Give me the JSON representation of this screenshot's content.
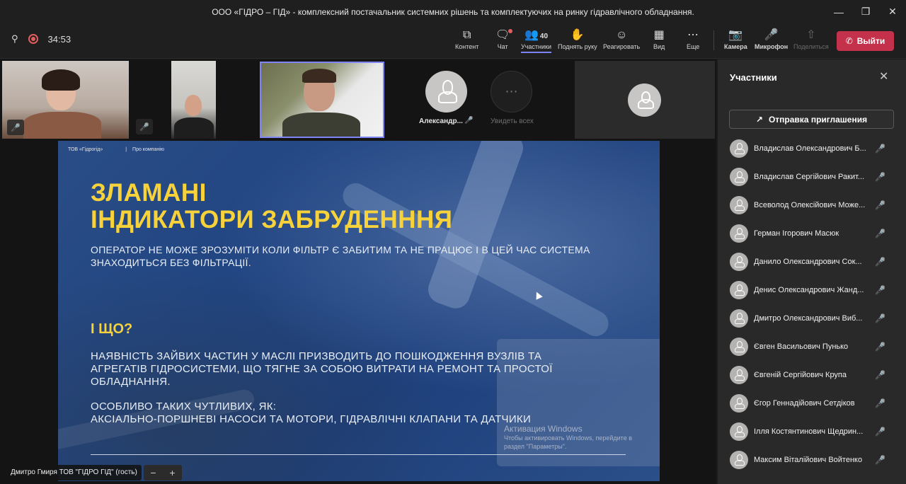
{
  "window": {
    "title": "ООО «ГІДРО – ГІД» - комплексний постачальник системних рішень та комплектуючих на ринку гідравлічного обладнання."
  },
  "toolbar": {
    "timer": "34:53",
    "content_label": "Контент",
    "chat_label": "Чат",
    "participants_label": "Участники",
    "participants_count": "40",
    "raise_hand_label": "Поднять руку",
    "react_label": "Реагировать",
    "view_label": "Вид",
    "more_label": "Еще",
    "camera_label": "Камера",
    "mic_label": "Микрофон",
    "share_label": "Поделиться",
    "leave_label": "Выйти",
    "leave_color": "#c4314b",
    "accent_color": "#7f85f5"
  },
  "strip": {
    "tile4_name": "Александр...",
    "see_all_label": "Увидеть всех"
  },
  "slide": {
    "header_company": "ТОВ «Гідрогід»",
    "header_sep": "|",
    "header_section": "Про компанію",
    "title_line1": "ЗЛАМАНІ",
    "title_line2": "ІНДИКАТОРИ ЗАБРУДЕНННЯ",
    "para1_line1": "ОПЕРАТОР НЕ МОЖЕ ЗРОЗУМІТИ КОЛИ ФІЛЬТР Є ЗАБИТИМ ТА НЕ ПРАЦЮЄ І В ЦЕЙ ЧАС СИСТЕМА",
    "para1_line2": "ЗНАХОДИТЬСЯ БЕЗ ФІЛЬТРАЦІЇ.",
    "subheading": "І ЩО?",
    "para2_line1": "НАЯВНІСТЬ ЗАЙВИХ ЧАСТИН У МАСЛІ ПРИЗВОДИТЬ ДО ПОШКОДЖЕННЯ ВУЗЛІВ ТА",
    "para2_line2": "АГРЕГАТІВ ГІДРОСИСТЕМИ, ЩО ТЯГНЕ ЗА СОБОЮ ВИТРАТИ НА РЕМОНТ ТА ПРОСТОЇ",
    "para2_line3": "ОБЛАДНАННЯ.",
    "para3_line1": "ОСОБЛИВО ТАКИХ ЧУТЛИВИХ, ЯК:",
    "para3_line2": "АКСІАЛЬНО-ПОРШНЕВІ НАСОСИ ТА МОТОРИ, ГІДРАВЛІЧНІ КЛАПАНИ ТА ДАТЧИКИ",
    "title_color": "#f7d23a"
  },
  "activation": {
    "line1": "Активация Windows",
    "line2": "Чтобы активировать Windows, перейдите в",
    "line3": "раздел \"Параметры\"."
  },
  "presenter": {
    "name": "Дмитро Гмиря ТОВ \"ГІДРО ГІД\" (гость)",
    "zoom_out": "−",
    "zoom_in": "+"
  },
  "panel": {
    "title": "Участники",
    "invite_label": "Отправка приглашения",
    "participants": [
      "Владислав Олександрович Б...",
      "Владислав Сергійович Ракит...",
      "Всеволод Олексійович Може...",
      "Герман Ігорович Масюк",
      "Данило Олександрович Сок...",
      "Денис Олександрович Жанд...",
      "Дмитро Олександрович Виб...",
      "Євген Васильович Пунько",
      "Євгеній Сергійович Крупа",
      "Єгор Геннадійович Сетдіков",
      "Ілля Костянтинович Щедрин...",
      "Максим Віталійович Войтенко"
    ]
  }
}
